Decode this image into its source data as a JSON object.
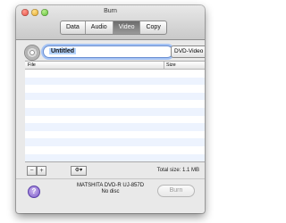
{
  "window": {
    "title": "Burn"
  },
  "tabs": [
    {
      "label": "Data"
    },
    {
      "label": "Audio"
    },
    {
      "label": "Video",
      "active": true
    },
    {
      "label": "Copy"
    }
  ],
  "disc": {
    "name_value": "Untitled",
    "format_selected": "DVD-Video"
  },
  "table": {
    "columns": [
      "File",
      "Size"
    ],
    "rows": []
  },
  "footer": {
    "remove_label": "−",
    "add_label": "+",
    "gear_label": "⚙▾",
    "total_size": "Total size: 1.1 MB"
  },
  "status": {
    "drive_name": "MATSHITA DVD-R UJ-857D",
    "drive_status": "No disc",
    "help_label": "?",
    "burn_label": "Burn",
    "burn_enabled": false
  },
  "colors": {
    "accent": "#3b77d8",
    "row_stripe": "#edf3fe",
    "help": "#7a58c9"
  },
  "icons": [
    "close-light",
    "minimize-light",
    "zoom-light",
    "disc-icon",
    "gear-icon",
    "help-icon"
  ]
}
